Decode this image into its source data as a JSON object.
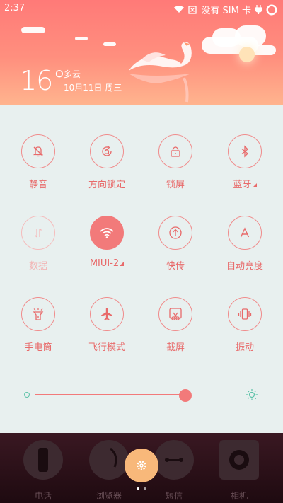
{
  "status": {
    "time": "2:37",
    "carrier": "没有 SIM 卡"
  },
  "weather": {
    "temperature": "16°",
    "condition": "多云",
    "date": "10月11日 周三"
  },
  "toggles": [
    {
      "label": "静音",
      "icon": "bell-off-icon",
      "state": "off"
    },
    {
      "label": "方向锁定",
      "icon": "rotation-lock-icon",
      "state": "off"
    },
    {
      "label": "锁屏",
      "icon": "lock-icon",
      "state": "off"
    },
    {
      "label": "蓝牙",
      "icon": "bluetooth-icon",
      "state": "off",
      "has_menu": true
    },
    {
      "label": "数据",
      "icon": "data-arrows-icon",
      "state": "disabled"
    },
    {
      "label": "MIUI-2",
      "icon": "wifi-icon",
      "state": "on",
      "has_menu": true
    },
    {
      "label": "快传",
      "icon": "share-icon",
      "state": "off"
    },
    {
      "label": "自动亮度",
      "icon": "auto-brightness-icon",
      "state": "off"
    },
    {
      "label": "手电筒",
      "icon": "flashlight-icon",
      "state": "off"
    },
    {
      "label": "飞行模式",
      "icon": "airplane-icon",
      "state": "off"
    },
    {
      "label": "截屏",
      "icon": "screenshot-icon",
      "state": "off"
    },
    {
      "label": "振动",
      "icon": "vibrate-icon",
      "state": "off"
    }
  ],
  "brightness": {
    "level": 0.73
  },
  "dock": {
    "apps": [
      {
        "label": "电话",
        "icon": "phone-icon"
      },
      {
        "label": "浏览器",
        "icon": "browser-icon"
      },
      {
        "label": "短信",
        "icon": "messages-icon"
      },
      {
        "label": "相机",
        "icon": "camera-icon"
      }
    ]
  },
  "colors": {
    "accent": "#f27a7a",
    "panel_bg": "#e8f0ef",
    "header_top": "#ff7a78",
    "header_bottom": "#ffb48e"
  }
}
